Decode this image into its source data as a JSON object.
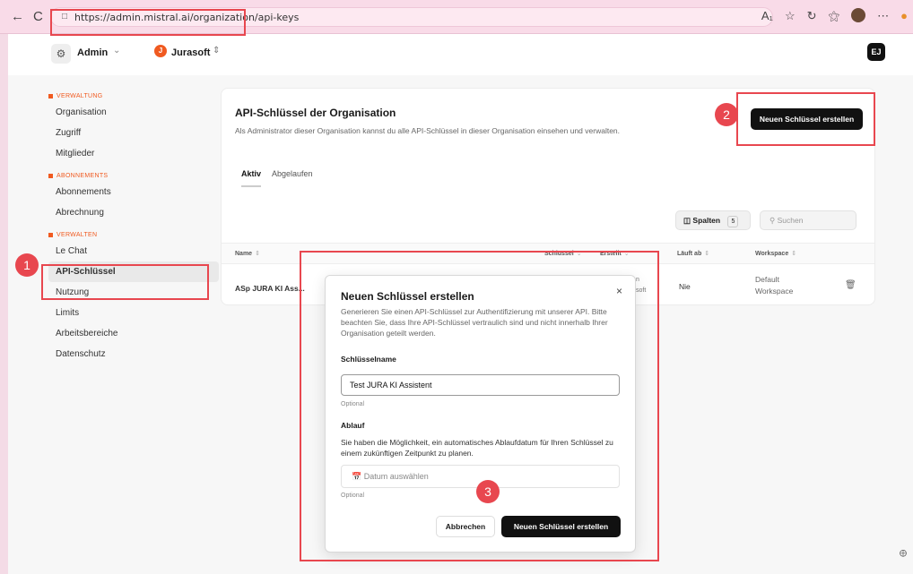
{
  "browser": {
    "url": "https://admin.mistral.ai/organization/api-keys",
    "back": "←",
    "reload": "C"
  },
  "header": {
    "workspace_label": "Admin",
    "org_initial": "J",
    "org_name": "Jurasoft",
    "user_initials": "EJ"
  },
  "sidebar": {
    "sections": [
      {
        "title": "VERWALTUNG",
        "items": [
          "Organisation",
          "Zugriff",
          "Mitglieder"
        ]
      },
      {
        "title": "ABONNEMENTS",
        "items": [
          "Abonnements",
          "Abrechnung"
        ]
      },
      {
        "title": "VERWALTEN",
        "items": [
          "Le Chat",
          "API-Schlüssel",
          "Nutzung",
          "Limits",
          "Arbeitsbereiche",
          "Datenschutz"
        ]
      }
    ],
    "active_item": "API-Schlüssel"
  },
  "card": {
    "title": "API-Schlüssel der Organisation",
    "description": "Als Administrator dieser Organisation kannst du alle API-Schlüssel in dieser Organisation einsehen und verwalten.",
    "new_key_button": "Neuen Schlüssel erstellen",
    "tabs": [
      {
        "label": "Aktiv",
        "active": true
      },
      {
        "label": "Abgelaufen",
        "active": false
      }
    ],
    "columns_button": "Spalten",
    "columns_count": "5",
    "search_placeholder": "Suchen",
    "table": {
      "headers": [
        "Name",
        "Schlüssel",
        "Erstellt",
        "Läuft ab",
        "Workspace"
      ],
      "rows": [
        {
          "name": "ASp JURA KI Ass...",
          "created_fragment_1": "n",
          "created_fragment_2": "soft",
          "expires": "Nie",
          "workspace_line1": "Default",
          "workspace_line2": "Workspace"
        }
      ]
    }
  },
  "modal": {
    "title": "Neuen Schlüssel erstellen",
    "description": "Generieren Sie einen API-Schlüssel zur Authentifizierung mit unserer API. Bitte beachten Sie, dass Ihre API-Schlüssel vertraulich sind und nicht innerhalb Ihrer Organisation geteilt werden.",
    "name_label": "Schlüsselname",
    "name_value": "Test JURA KI Assistent",
    "name_hint": "Optional",
    "expiry_label": "Ablauf",
    "expiry_description": "Sie haben die Möglichkeit, ein automatisches Ablaufdatum für Ihren Schlüssel zu einem zukünftigen Zeitpunkt zu planen.",
    "date_placeholder": "Datum auswählen",
    "date_hint": "Optional",
    "cancel_button": "Abbrechen",
    "create_button": "Neuen Schlüssel erstellen",
    "close": "×"
  },
  "annotations": {
    "markers": [
      "1",
      "2",
      "3"
    ],
    "color": "#e8474f"
  },
  "colors": {
    "accent": "#f05a20",
    "primary_button": "#111111",
    "browser_bar": "#f9dbe8"
  }
}
